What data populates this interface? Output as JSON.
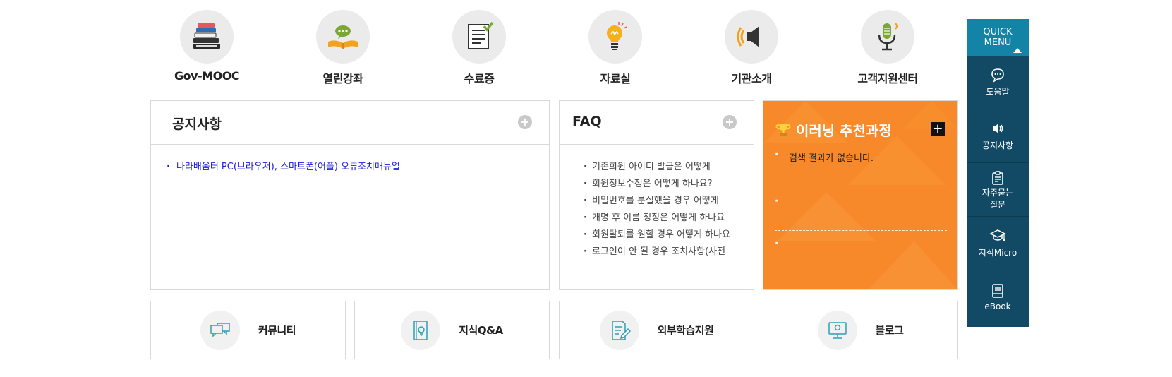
{
  "top_icons": [
    {
      "label": "Gov-MOOC",
      "icon": "books-icon"
    },
    {
      "label": "열린강좌",
      "icon": "open-book-chat-icon"
    },
    {
      "label": "수료증",
      "icon": "certificate-icon"
    },
    {
      "label": "자료실",
      "icon": "lightbulb-icon"
    },
    {
      "label": "기관소개",
      "icon": "speaker-icon"
    },
    {
      "label": "고객지원센터",
      "icon": "microphone-icon"
    }
  ],
  "notice": {
    "title": "공지사항",
    "plus": "+",
    "items": [
      "나라배움터 PC(브라우저), 스마트폰(어플) 오류조치매뉴얼"
    ]
  },
  "faq": {
    "title": "FAQ",
    "plus": "+",
    "items": [
      "기존회원 아이디 발급은 어떻게",
      "회원정보수정은 어떻게 하나요?",
      "비밀번호를 분실했을 경우 어떻게",
      "개명 후 이름 정정은 어떻게 하나요",
      "회원탈퇴를 원할 경우 어떻게 하나요",
      "로그인이 안 될 경우 조치사항(사전"
    ]
  },
  "elearning": {
    "title": "이러닝 추천과정",
    "plus": "+",
    "rows": [
      "검색 결과가 없습니다.",
      "",
      ""
    ],
    "icon": "trophy-icon",
    "color": "#f7892a"
  },
  "links": [
    {
      "label": "커뮤니티",
      "icon": "chat-bubbles-icon"
    },
    {
      "label": "지식Q&A",
      "icon": "book-lightbulb-icon"
    },
    {
      "label": "외부학습지원",
      "icon": "document-pen-icon"
    },
    {
      "label": "블로그",
      "icon": "monitor-icon"
    }
  ],
  "quick_menu": {
    "title_line1": "QUICK",
    "title_line2": "MENU",
    "items": [
      {
        "label": "도움말",
        "icon": "chat-bubble-icon"
      },
      {
        "label": "공지사항",
        "icon": "speaker-icon"
      },
      {
        "label_line1": "자주묻는",
        "label_line2": "질문",
        "icon": "clipboard-icon"
      },
      {
        "label": "지식Micro",
        "icon": "graduation-cap-icon"
      },
      {
        "label": "eBook",
        "icon": "ebook-icon"
      }
    ],
    "bg_color": "#124a66",
    "head_color": "#1484a6"
  }
}
